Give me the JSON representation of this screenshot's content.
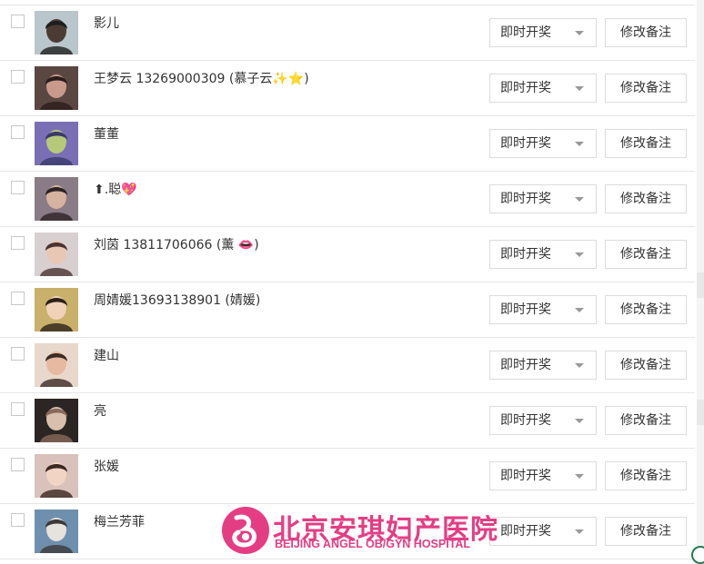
{
  "rows": [
    {
      "name": "影儿",
      "select": "即时开奖",
      "button": "修改备注",
      "avatar": {
        "bg": "#b9c6cc",
        "fg": "#4b3b33",
        "accent": "#1e1e1e"
      }
    },
    {
      "name": "王梦云 13269000309 (慕子云✨⭐)",
      "select": "即时开奖",
      "button": "修改备注",
      "avatar": {
        "bg": "#5b4742",
        "fg": "#c99a8c",
        "accent": "#2a1d1b"
      }
    },
    {
      "name": "董董",
      "select": "即时开奖",
      "button": "修改备注",
      "avatar": {
        "bg": "#7a6fb5",
        "fg": "#b6c97a",
        "accent": "#3a3a6a"
      }
    },
    {
      "name": "⬆.聪💖",
      "select": "即时开奖",
      "button": "修改备注",
      "avatar": {
        "bg": "#8a7c86",
        "fg": "#d6b3a0",
        "accent": "#2d2226"
      }
    },
    {
      "name": "刘茵 13811706066 (薰 👄)",
      "select": "即时开奖",
      "button": "修改备注",
      "avatar": {
        "bg": "#d8cfd0",
        "fg": "#e9c7b5",
        "accent": "#4a3332"
      }
    },
    {
      "name": "周婧媛13693138901 (婧媛)",
      "select": "即时开奖",
      "button": "修改备注",
      "avatar": {
        "bg": "#c9b06b",
        "fg": "#f0d2b8",
        "accent": "#2c2118"
      }
    },
    {
      "name": "建山",
      "select": "即时开奖",
      "button": "修改备注",
      "avatar": {
        "bg": "#e8d8cc",
        "fg": "#e7b9a0",
        "accent": "#3b2c26"
      }
    },
    {
      "name": "亮",
      "select": "即时开奖",
      "button": "修改备注",
      "avatar": {
        "bg": "#2b2623",
        "fg": "#d8bfae",
        "accent": "#8a6a5a"
      }
    },
    {
      "name": "张媛",
      "select": "即时开奖",
      "button": "修改备注",
      "avatar": {
        "bg": "#d9c2bb",
        "fg": "#f2d4c4",
        "accent": "#3a2822"
      }
    },
    {
      "name": "梅兰芳菲",
      "select": "即时开奖",
      "button": "修改备注",
      "avatar": {
        "bg": "#6f8fae",
        "fg": "#e6e2dc",
        "accent": "#3b3a3a"
      }
    }
  ],
  "watermark": {
    "cn": "北京安琪妇产医院",
    "en": "BEIJING ANGEL OB/GYN HOSPITAL",
    "color": "#e53d84"
  },
  "colors": {
    "border": "#e6e6e6",
    "caret": "#999999",
    "text": "#333333"
  }
}
